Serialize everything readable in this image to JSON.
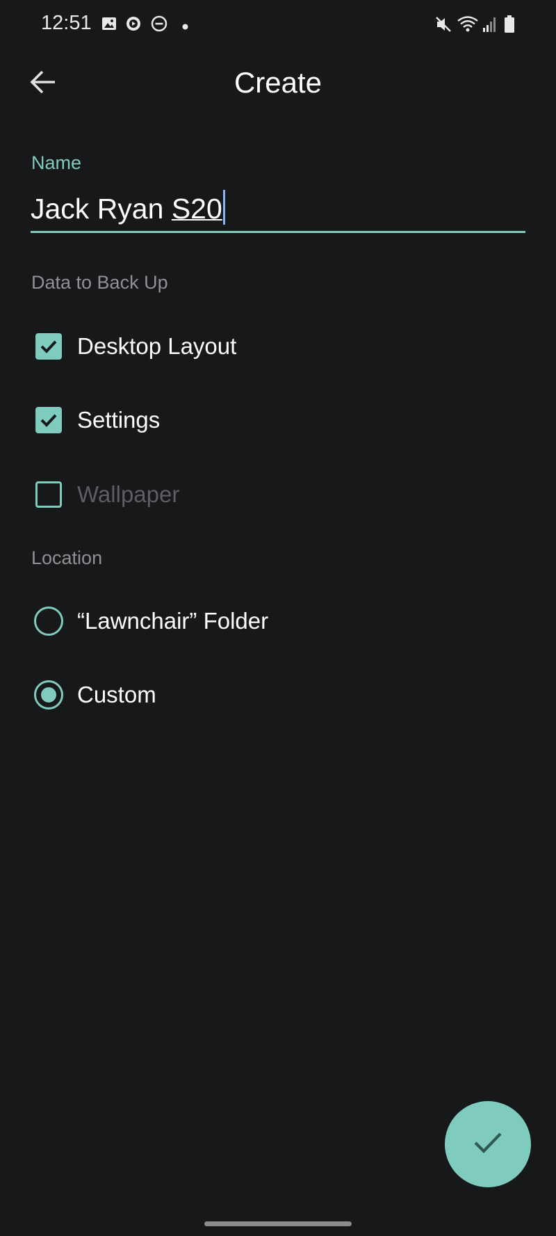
{
  "status_bar": {
    "time": "12:51",
    "left_icons": [
      "image-icon",
      "play-circle-icon",
      "do-not-disturb-icon",
      "dot-icon"
    ],
    "right_icons": [
      "mute-icon",
      "wifi-icon",
      "signal-icon",
      "battery-icon"
    ]
  },
  "app_bar": {
    "title": "Create",
    "back_icon": "arrow-left-icon"
  },
  "name_field": {
    "label": "Name",
    "value_plain": "Jack Ryan ",
    "value_composing": "S20",
    "value": "Jack Ryan S20"
  },
  "backup_section": {
    "label": "Data to Back Up",
    "options": [
      {
        "label": "Desktop Layout",
        "checked": true,
        "enabled": true
      },
      {
        "label": "Settings",
        "checked": true,
        "enabled": true
      },
      {
        "label": "Wallpaper",
        "checked": false,
        "enabled": false
      }
    ]
  },
  "location_section": {
    "label": "Location",
    "options": [
      {
        "label": "“Lawnchair” Folder",
        "selected": false
      },
      {
        "label": "Custom",
        "selected": true
      }
    ]
  },
  "fab": {
    "icon": "check-icon"
  },
  "colors": {
    "background": "#17181a",
    "accent": "#7fcbbe",
    "text_primary": "#ffffff",
    "text_secondary": "#8f9194",
    "text_disabled": "#5c5e61"
  }
}
